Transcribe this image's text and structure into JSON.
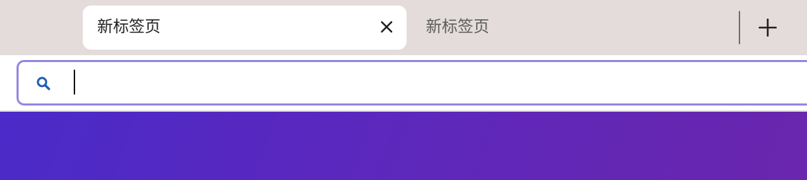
{
  "tabs": [
    {
      "label": "新标签页",
      "active": true
    },
    {
      "label": "新标签页",
      "active": false
    }
  ],
  "urlbar": {
    "value": "",
    "placeholder": ""
  },
  "icons": {
    "close": "close-icon",
    "new_tab": "plus-icon",
    "search": "search-icon"
  },
  "colors": {
    "tabstrip_bg": "#e3dcda",
    "urlbar_focus_border": "#9187e0",
    "search_icon": "#1f5fb3",
    "content_gradient_start": "#4a2ac8",
    "content_gradient_end": "#6a26ad"
  }
}
